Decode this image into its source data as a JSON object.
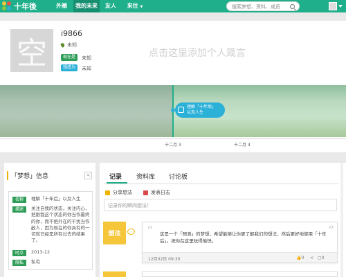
{
  "topbar": {
    "logo_text": "十年後",
    "nav": [
      {
        "label": "外圈",
        "active": false
      },
      {
        "label": "我的未来",
        "active": true
      },
      {
        "label": "友人",
        "active": false
      },
      {
        "label": "来往",
        "active": false
      }
    ],
    "search_placeholder": "搜索梦想、资料、成员",
    "brand_color": "#1faf8a"
  },
  "profile": {
    "avatar_glyph": "空",
    "username": "i9866",
    "location": "未知",
    "tags": [
      {
        "label": "现在是",
        "value": "未知",
        "color": "#2e9d57"
      },
      {
        "label": "想成为",
        "value": "未知",
        "color": "#2bb0d8"
      }
    ],
    "motto_placeholder": "点击这里添加个人箴言"
  },
  "timeline": {
    "bubble_text": [
      "理解「十年后」",
      "以及人生"
    ],
    "ticks": [
      "十二月 3",
      "十二月 4"
    ]
  },
  "dream_info": {
    "title": "「梦想」信息",
    "share_icon": "share-icon",
    "rows": [
      {
        "label": "名称",
        "value": "理解「十年后」以及人生"
      },
      {
        "label": "描述",
        "value": "关注自我的状态，关注内心，把跟我这个状态的你当作最终的你，而不把外在的干扰当作敌人，因为现在的你具有的一切就已经是所有过去的结果了。"
      },
      {
        "label": "时点",
        "value": "2013-12"
      },
      {
        "label": "隐私",
        "value": "私有"
      }
    ]
  },
  "main": {
    "tabs": [
      {
        "label": "记录",
        "active": true
      },
      {
        "label": "资料库",
        "active": false
      },
      {
        "label": "讨论板",
        "active": false
      }
    ],
    "actions": [
      {
        "label": "分享想法",
        "icon": "idea-icon",
        "color": "#f0b400"
      },
      {
        "label": "发表日志",
        "icon": "journal-icon",
        "color": "#d94b4b"
      }
    ],
    "composer_placeholder": "记录你的瞬间想法！",
    "posts": [
      {
        "chip": "想法",
        "text": "这是一个「预测」的梦想，希望能够让你更了解我们的想法，然后更好地使用「十年后」。祝你在这里玩得愉快。",
        "date": "12月02日 09:30",
        "likes": "0",
        "comments": "0"
      },
      {
        "chip": "",
        "text": "",
        "date": "",
        "likes": "",
        "comments": ""
      }
    ]
  }
}
